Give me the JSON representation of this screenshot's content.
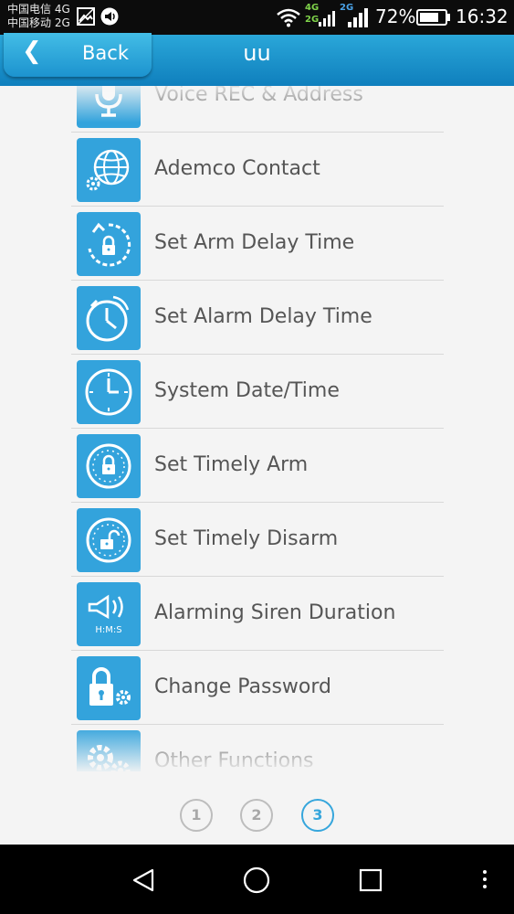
{
  "status_bar": {
    "carrier_1": "中国电信 4G",
    "carrier_2": "中国移动 2G",
    "net_1": "4G",
    "net_2": "2G",
    "net_3": "2G",
    "battery": "72%",
    "time": "16:32"
  },
  "header": {
    "back_label": "Back",
    "title": "uu"
  },
  "menu_items": [
    {
      "label": "Voice REC & Address",
      "icon": "microphone-icon"
    },
    {
      "label": "Ademco Contact",
      "icon": "globe-gear-icon"
    },
    {
      "label": "Set Arm Delay Time",
      "icon": "arm-delay-timer-icon"
    },
    {
      "label": "Set Alarm Delay Time",
      "icon": "alarm-delay-clock-icon"
    },
    {
      "label": "System Date/Time",
      "icon": "clock-icon"
    },
    {
      "label": "Set Timely Arm",
      "icon": "timed-lock-icon"
    },
    {
      "label": "Set Timely Disarm",
      "icon": "timed-unlock-icon"
    },
    {
      "label": "Alarming Siren Duration",
      "icon": "siren-hms-icon"
    },
    {
      "label": "Change Password",
      "icon": "lock-gear-icon"
    },
    {
      "label": "Other Functions",
      "icon": "gears-icon"
    }
  ],
  "siren_icon_text": "H:M:S",
  "pager": {
    "pages": [
      "1",
      "2",
      "3"
    ],
    "active": "3"
  },
  "colors": {
    "header": "#1a93cc",
    "icon_tile": "#33a3dc",
    "pager_active": "#36a6dc"
  }
}
